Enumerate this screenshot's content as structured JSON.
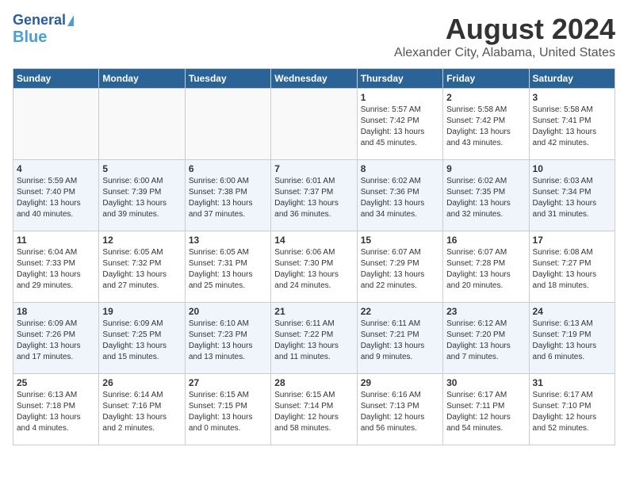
{
  "header": {
    "logo_line1": "General",
    "logo_line2": "Blue",
    "month_title": "August 2024",
    "location": "Alexander City, Alabama, United States"
  },
  "weekdays": [
    "Sunday",
    "Monday",
    "Tuesday",
    "Wednesday",
    "Thursday",
    "Friday",
    "Saturday"
  ],
  "weeks": [
    [
      {
        "day": "",
        "info": ""
      },
      {
        "day": "",
        "info": ""
      },
      {
        "day": "",
        "info": ""
      },
      {
        "day": "",
        "info": ""
      },
      {
        "day": "1",
        "info": "Sunrise: 5:57 AM\nSunset: 7:42 PM\nDaylight: 13 hours\nand 45 minutes."
      },
      {
        "day": "2",
        "info": "Sunrise: 5:58 AM\nSunset: 7:42 PM\nDaylight: 13 hours\nand 43 minutes."
      },
      {
        "day": "3",
        "info": "Sunrise: 5:58 AM\nSunset: 7:41 PM\nDaylight: 13 hours\nand 42 minutes."
      }
    ],
    [
      {
        "day": "4",
        "info": "Sunrise: 5:59 AM\nSunset: 7:40 PM\nDaylight: 13 hours\nand 40 minutes."
      },
      {
        "day": "5",
        "info": "Sunrise: 6:00 AM\nSunset: 7:39 PM\nDaylight: 13 hours\nand 39 minutes."
      },
      {
        "day": "6",
        "info": "Sunrise: 6:00 AM\nSunset: 7:38 PM\nDaylight: 13 hours\nand 37 minutes."
      },
      {
        "day": "7",
        "info": "Sunrise: 6:01 AM\nSunset: 7:37 PM\nDaylight: 13 hours\nand 36 minutes."
      },
      {
        "day": "8",
        "info": "Sunrise: 6:02 AM\nSunset: 7:36 PM\nDaylight: 13 hours\nand 34 minutes."
      },
      {
        "day": "9",
        "info": "Sunrise: 6:02 AM\nSunset: 7:35 PM\nDaylight: 13 hours\nand 32 minutes."
      },
      {
        "day": "10",
        "info": "Sunrise: 6:03 AM\nSunset: 7:34 PM\nDaylight: 13 hours\nand 31 minutes."
      }
    ],
    [
      {
        "day": "11",
        "info": "Sunrise: 6:04 AM\nSunset: 7:33 PM\nDaylight: 13 hours\nand 29 minutes."
      },
      {
        "day": "12",
        "info": "Sunrise: 6:05 AM\nSunset: 7:32 PM\nDaylight: 13 hours\nand 27 minutes."
      },
      {
        "day": "13",
        "info": "Sunrise: 6:05 AM\nSunset: 7:31 PM\nDaylight: 13 hours\nand 25 minutes."
      },
      {
        "day": "14",
        "info": "Sunrise: 6:06 AM\nSunset: 7:30 PM\nDaylight: 13 hours\nand 24 minutes."
      },
      {
        "day": "15",
        "info": "Sunrise: 6:07 AM\nSunset: 7:29 PM\nDaylight: 13 hours\nand 22 minutes."
      },
      {
        "day": "16",
        "info": "Sunrise: 6:07 AM\nSunset: 7:28 PM\nDaylight: 13 hours\nand 20 minutes."
      },
      {
        "day": "17",
        "info": "Sunrise: 6:08 AM\nSunset: 7:27 PM\nDaylight: 13 hours\nand 18 minutes."
      }
    ],
    [
      {
        "day": "18",
        "info": "Sunrise: 6:09 AM\nSunset: 7:26 PM\nDaylight: 13 hours\nand 17 minutes."
      },
      {
        "day": "19",
        "info": "Sunrise: 6:09 AM\nSunset: 7:25 PM\nDaylight: 13 hours\nand 15 minutes."
      },
      {
        "day": "20",
        "info": "Sunrise: 6:10 AM\nSunset: 7:23 PM\nDaylight: 13 hours\nand 13 minutes."
      },
      {
        "day": "21",
        "info": "Sunrise: 6:11 AM\nSunset: 7:22 PM\nDaylight: 13 hours\nand 11 minutes."
      },
      {
        "day": "22",
        "info": "Sunrise: 6:11 AM\nSunset: 7:21 PM\nDaylight: 13 hours\nand 9 minutes."
      },
      {
        "day": "23",
        "info": "Sunrise: 6:12 AM\nSunset: 7:20 PM\nDaylight: 13 hours\nand 7 minutes."
      },
      {
        "day": "24",
        "info": "Sunrise: 6:13 AM\nSunset: 7:19 PM\nDaylight: 13 hours\nand 6 minutes."
      }
    ],
    [
      {
        "day": "25",
        "info": "Sunrise: 6:13 AM\nSunset: 7:18 PM\nDaylight: 13 hours\nand 4 minutes."
      },
      {
        "day": "26",
        "info": "Sunrise: 6:14 AM\nSunset: 7:16 PM\nDaylight: 13 hours\nand 2 minutes."
      },
      {
        "day": "27",
        "info": "Sunrise: 6:15 AM\nSunset: 7:15 PM\nDaylight: 13 hours\nand 0 minutes."
      },
      {
        "day": "28",
        "info": "Sunrise: 6:15 AM\nSunset: 7:14 PM\nDaylight: 12 hours\nand 58 minutes."
      },
      {
        "day": "29",
        "info": "Sunrise: 6:16 AM\nSunset: 7:13 PM\nDaylight: 12 hours\nand 56 minutes."
      },
      {
        "day": "30",
        "info": "Sunrise: 6:17 AM\nSunset: 7:11 PM\nDaylight: 12 hours\nand 54 minutes."
      },
      {
        "day": "31",
        "info": "Sunrise: 6:17 AM\nSunset: 7:10 PM\nDaylight: 12 hours\nand 52 minutes."
      }
    ]
  ]
}
